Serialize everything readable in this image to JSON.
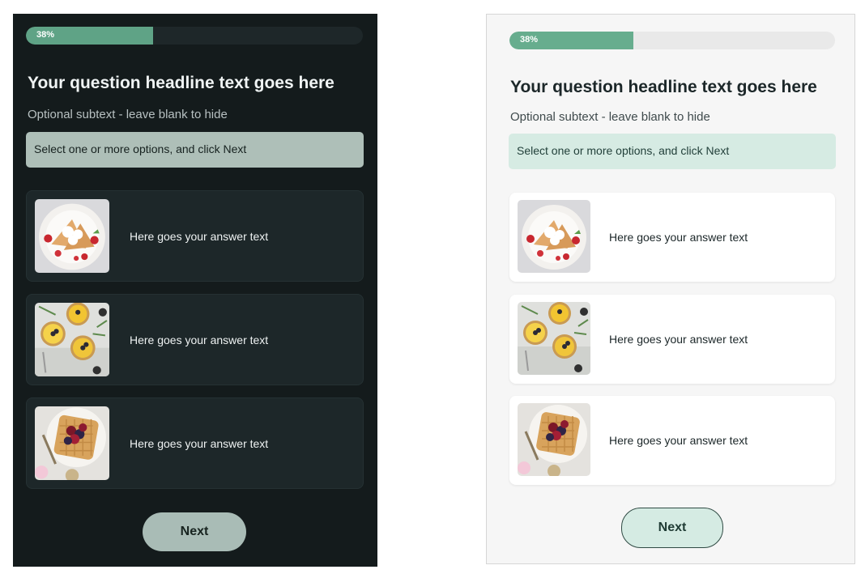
{
  "progress": {
    "value": 0.38,
    "label": "38%"
  },
  "question": {
    "headline": "Your question headline text goes here",
    "subtext": "Optional subtext - leave blank to hide",
    "instruction": "Select one or more options, and click Next"
  },
  "options": [
    {
      "text": "Here goes your answer text",
      "image": "crepes-with-strawberries-photo"
    },
    {
      "text": "Here goes your answer text",
      "image": "citrus-tarts-photo"
    },
    {
      "text": "Here goes your answer text",
      "image": "berry-waffle-photo"
    }
  ],
  "next_label": "Next",
  "themes": {
    "dark": {
      "background": "#141b1c",
      "accent": "#5fa386",
      "button": "#a9bcb6"
    },
    "light": {
      "background": "#f6f6f6",
      "accent": "#67ad8e",
      "button": "#d5ebe3"
    }
  }
}
